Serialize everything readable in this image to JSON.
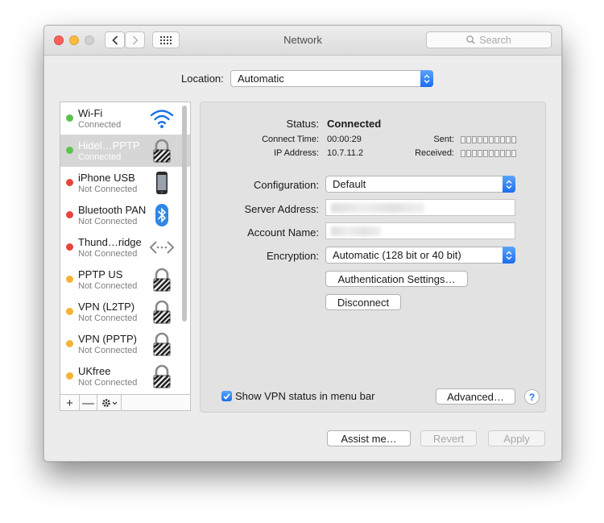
{
  "window": {
    "title": "Network",
    "search_placeholder": "Search",
    "location_label": "Location:",
    "location_value": "Automatic"
  },
  "services": [
    {
      "name": "Wi-Fi",
      "state": "Connected",
      "status_color": "#5cc24d",
      "icon": "wifi-icon",
      "selected": false
    },
    {
      "name": "Hidel…PPTP",
      "state": "Connected",
      "status_color": "#5cc24d",
      "icon": "lock-icon",
      "selected": true
    },
    {
      "name": "iPhone USB",
      "state": "Not Connected",
      "status_color": "#e8443a",
      "icon": "iphone-icon",
      "selected": false
    },
    {
      "name": "Bluetooth PAN",
      "state": "Not Connected",
      "status_color": "#e8443a",
      "icon": "bluetooth-icon",
      "selected": false
    },
    {
      "name": "Thund…ridge",
      "state": "Not Connected",
      "status_color": "#e8443a",
      "icon": "thunderbolt-bridge-icon",
      "selected": false
    },
    {
      "name": "PPTP US",
      "state": "Not Connected",
      "status_color": "#f5b335",
      "icon": "lock-icon",
      "selected": false
    },
    {
      "name": "VPN (L2TP)",
      "state": "Not Connected",
      "status_color": "#f5b335",
      "icon": "lock-icon",
      "selected": false
    },
    {
      "name": "VPN (PPTP)",
      "state": "Not Connected",
      "status_color": "#f5b335",
      "icon": "lock-icon",
      "selected": false
    },
    {
      "name": "UKfree",
      "state": "Not Connected",
      "status_color": "#f5b335",
      "icon": "lock-icon",
      "selected": false
    }
  ],
  "sidebar_tools": {
    "add": "+",
    "remove": "—"
  },
  "detail": {
    "status_label": "Status:",
    "status_value": "Connected",
    "connect_time_label": "Connect Time:",
    "connect_time_value": "00:00:29",
    "ip_label": "IP Address:",
    "ip_value": "10.7.11.2",
    "sent_label": "Sent:",
    "received_label": "Received:",
    "configuration_label": "Configuration:",
    "configuration_value": "Default",
    "server_label": "Server Address:",
    "account_label": "Account Name:",
    "encryption_label": "Encryption:",
    "encryption_value": "Automatic (128 bit or 40 bit)",
    "auth_button": "Authentication Settings…",
    "disconnect_button": "Disconnect",
    "show_vpn_label": "Show VPN status in menu bar",
    "show_vpn_checked": true,
    "advanced_button": "Advanced…",
    "help_button": "?"
  },
  "footer": {
    "assist": "Assist me…",
    "revert": "Revert",
    "apply": "Apply"
  },
  "colors": {
    "accent": "#1a6df0",
    "connected": "#5cc24d",
    "not_connected": "#e8443a",
    "inactive": "#f5b335"
  }
}
